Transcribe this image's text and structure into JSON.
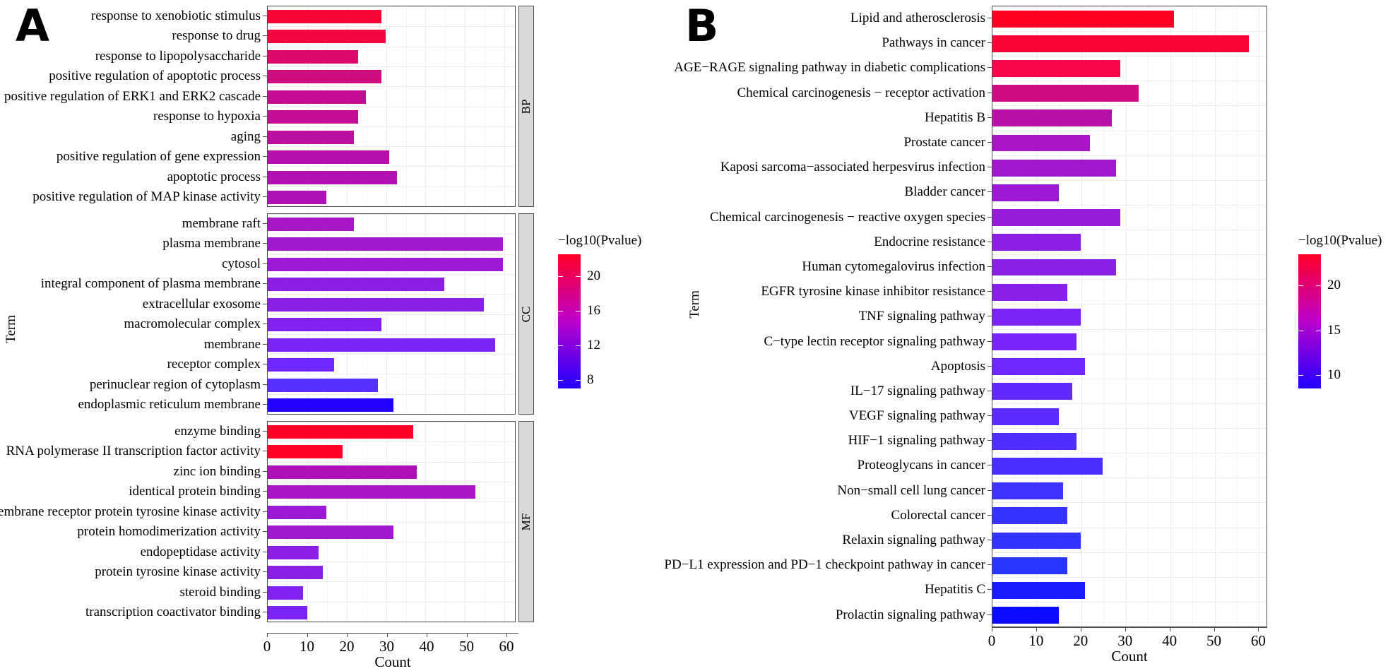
{
  "figure": {
    "panels": [
      {
        "letter": "A",
        "y_axis_title": "Term",
        "x_axis_title": "Count",
        "x_ticks": [
          0,
          10,
          20,
          30,
          40,
          50,
          60
        ],
        "x_max": 63,
        "legend": {
          "title": "−log10(Pvalue)",
          "ticks": [
            20,
            16,
            12,
            8
          ],
          "vmin": 7,
          "vmax": 22.5,
          "color_high": "#FF0026",
          "color_mid": "#C000C8",
          "color_low": "#2200FF"
        }
      },
      {
        "letter": "B",
        "y_axis_title": "Term",
        "x_axis_title": "Count",
        "x_ticks": [
          0,
          10,
          20,
          30,
          40,
          50,
          60
        ],
        "x_max": 62,
        "legend": {
          "title": "−log10(Pvalue)",
          "ticks": [
            20,
            15,
            10
          ],
          "vmin": 8.5,
          "vmax": 23.5,
          "color_high": "#FF0026",
          "color_mid": "#C000C8",
          "color_low": "#2200FF"
        }
      }
    ]
  },
  "chart_data": [
    {
      "type": "bar",
      "title": "A",
      "orientation": "horizontal",
      "xlabel": "Count",
      "ylabel": "Term",
      "xlim": [
        0,
        63
      ],
      "grid": true,
      "legend_position": "right",
      "color_label": "−log10(Pvalue)",
      "facets": [
        {
          "name": "BP",
          "categories": [
            "response to xenobiotic stimulus",
            "response to drug",
            "response to lipopolysaccharide",
            "positive regulation of apoptotic process",
            "positive regulation of ERK1 and ERK2 cascade",
            "response to hypoxia",
            "aging",
            "positive regulation of gene expression",
            "apoptotic process",
            "positive regulation of MAP kinase activity"
          ],
          "values": [
            29,
            30,
            23,
            29,
            25,
            23,
            22,
            31,
            33,
            15
          ],
          "colors": [
            "#F60733",
            "#F20740",
            "#DB0B6E",
            "#D00C81",
            "#C60D92",
            "#C40D95",
            "#BC0E9F",
            "#B510AC",
            "#B111B2",
            "#AE12B6"
          ]
        },
        {
          "name": "CC",
          "categories": [
            "membrane raft",
            "plasma membrane",
            "cytosol",
            "integral component of plasma membrane",
            "extracellular exosome",
            "macromolecular complex",
            "membrane",
            "receptor complex",
            "perinuclear region of cytoplasm",
            "endoplasmic reticulum membrane"
          ],
          "values": [
            22,
            60,
            60,
            45,
            55,
            29,
            58,
            17,
            28,
            32
          ],
          "colors": [
            "#A815C3",
            "#9E18CE",
            "#9A19D3",
            "#8C1EE3",
            "#8A1FE6",
            "#8021F0",
            "#7B23F4",
            "#6E28FF",
            "#5830FF",
            "#2200FF"
          ]
        },
        {
          "name": "MF",
          "categories": [
            "enzyme binding",
            "RNA polymerase II transcription factor activity",
            "zinc ion binding",
            "identical protein binding",
            "transmembrane receptor protein tyrosine kinase activity",
            "protein homodimerization activity",
            "endopeptidase activity",
            "protein tyrosine kinase activity",
            "steroid binding",
            "transcription coactivator binding"
          ],
          "values": [
            37,
            19,
            38,
            53,
            15,
            32,
            13,
            14,
            9,
            10
          ],
          "colors": [
            "#FF0026",
            "#FF0026",
            "#AE12B6",
            "#A815C3",
            "#9A19D3",
            "#9E18CE",
            "#8C1EE3",
            "#8A1FE6",
            "#8021F0",
            "#7B23F4"
          ]
        }
      ]
    },
    {
      "type": "bar",
      "title": "B",
      "orientation": "horizontal",
      "xlabel": "Count",
      "ylabel": "Term",
      "xlim": [
        0,
        62
      ],
      "grid": true,
      "legend_position": "right",
      "color_label": "−log10(Pvalue)",
      "categories": [
        "Lipid and atherosclerosis",
        "Pathways in cancer",
        "AGE−RAGE signaling pathway in diabetic complications",
        "Chemical carcinogenesis − receptor activation",
        "Hepatitis B",
        "Prostate cancer",
        "Kaposi sarcoma−associated herpesvirus infection",
        "Bladder cancer",
        "Chemical carcinogenesis − reactive oxygen species",
        "Endocrine resistance",
        "Human cytomegalovirus infection",
        "EGFR tyrosine kinase inhibitor resistance",
        "TNF signaling pathway",
        "C−type lectin receptor signaling pathway",
        "Apoptosis",
        "IL−17 signaling pathway",
        "VEGF signaling pathway",
        "HIF−1 signaling pathway",
        "Proteoglycans in cancer",
        "Non−small cell lung cancer",
        "Colorectal cancer",
        "Relaxin signaling pathway",
        "PD−L1 expression and PD−1 checkpoint pathway in cancer",
        "Hepatitis C",
        "Prolactin signaling pathway"
      ],
      "values": [
        41,
        58,
        29,
        33,
        27,
        22,
        28,
        15,
        29,
        20,
        28,
        17,
        20,
        19,
        21,
        18,
        15,
        19,
        25,
        16,
        17,
        20,
        17,
        21,
        15
      ],
      "colors": [
        "#FF0024",
        "#FA0535",
        "#F5064A",
        "#CE0C85",
        "#B810A9",
        "#A715C4",
        "#A117CB",
        "#9A19D3",
        "#951BD8",
        "#8C1EE3",
        "#8A1FE6",
        "#8620EA",
        "#7C22F3",
        "#7724F7",
        "#6E28FF",
        "#6229FF",
        "#5A2CFF",
        "#502EFF",
        "#4730FF",
        "#3D32FF",
        "#3633FF",
        "#2F34FF",
        "#2835FF",
        "#1A1DFF",
        "#0A0AFF"
      ]
    }
  ]
}
